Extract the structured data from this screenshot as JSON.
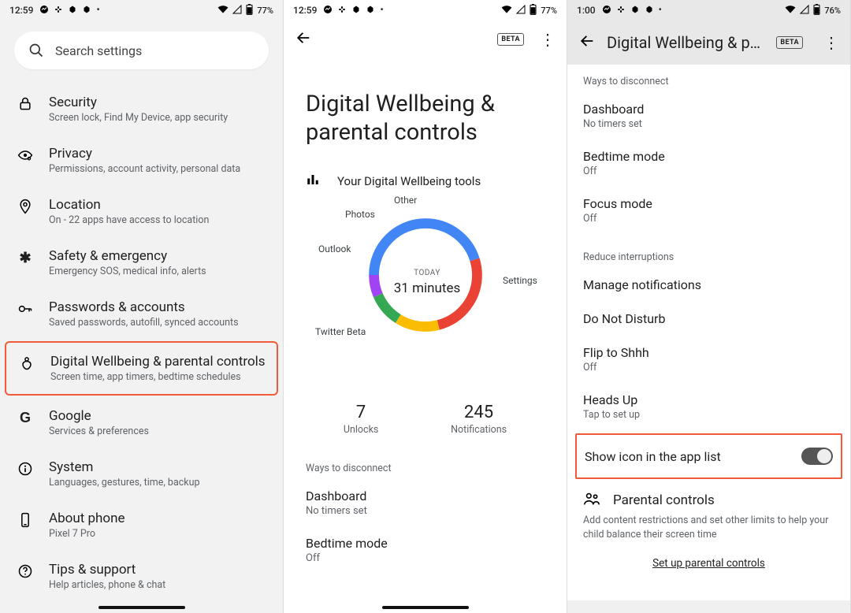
{
  "screen1": {
    "status": {
      "time": "12:59",
      "battery": "77%"
    },
    "search_placeholder": "Search settings",
    "items": [
      {
        "icon": "lock-icon",
        "title": "Security",
        "sub": "Screen lock, Find My Device, app security"
      },
      {
        "icon": "eye-icon",
        "title": "Privacy",
        "sub": "Permissions, account activity, personal data"
      },
      {
        "icon": "location-icon",
        "title": "Location",
        "sub": "On - 22 apps have access to location"
      },
      {
        "icon": "medical-icon",
        "title": "Safety & emergency",
        "sub": "Emergency SOS, medical info, alerts"
      },
      {
        "icon": "key-icon",
        "title": "Passwords & accounts",
        "sub": "Saved passwords, autofill, synced accounts"
      },
      {
        "icon": "wellbeing-icon",
        "title": "Digital Wellbeing & parental controls",
        "sub": "Screen time, app timers, bedtime schedules"
      },
      {
        "icon": "google-icon",
        "title": "Google",
        "sub": "Services & preferences"
      },
      {
        "icon": "info-icon",
        "title": "System",
        "sub": "Languages, gestures, time, backup"
      },
      {
        "icon": "phone-icon",
        "title": "About phone",
        "sub": "Pixel 7 Pro"
      },
      {
        "icon": "help-icon",
        "title": "Tips & support",
        "sub": "Help articles, phone & chat"
      }
    ]
  },
  "screen2": {
    "status": {
      "time": "12:59",
      "battery": "77%"
    },
    "beta_label": "BETA",
    "page_title": "Digital Wellbeing & parental controls",
    "tools_heading": "Your Digital Wellbeing tools",
    "donut_center": {
      "today": "TODAY",
      "value": "31 minutes"
    },
    "metrics": [
      {
        "value": "7",
        "label": "Unlocks"
      },
      {
        "value": "245",
        "label": "Notifications"
      }
    ],
    "section_ways": "Ways to disconnect",
    "rows": [
      {
        "title": "Dashboard",
        "sub": "No timers set"
      },
      {
        "title": "Bedtime mode",
        "sub": "Off"
      }
    ]
  },
  "chart_data": {
    "type": "pie",
    "title": "Your Digital Wellbeing tools",
    "categories": [
      "Settings",
      "Twitter Beta",
      "Outlook",
      "Photos",
      "Other"
    ],
    "values": [
      14,
      8,
      4,
      3,
      2
    ],
    "colors": [
      "#4285f4",
      "#ea4335",
      "#fbbc04",
      "#34a853",
      "#a142f4"
    ],
    "center_label_top": "TODAY",
    "center_label_main": "31 minutes"
  },
  "screen3": {
    "status": {
      "time": "1:00",
      "battery": "76%"
    },
    "beta_label": "BETA",
    "appbar_title": "Digital Wellbeing & pare...",
    "section_ways": "Ways to disconnect",
    "rows_ways": [
      {
        "title": "Dashboard",
        "sub": "No timers set"
      },
      {
        "title": "Bedtime mode",
        "sub": "Off"
      },
      {
        "title": "Focus mode",
        "sub": "Off"
      }
    ],
    "section_reduce": "Reduce interruptions",
    "rows_reduce": [
      {
        "title": "Manage notifications",
        "sub": ""
      },
      {
        "title": "Do Not Disturb",
        "sub": ""
      },
      {
        "title": "Flip to Shhh",
        "sub": "Off"
      },
      {
        "title": "Heads Up",
        "sub": "Tap to set up"
      }
    ],
    "show_icon_label": "Show icon in the app list",
    "pc_title": "Parental controls",
    "pc_sub": "Add content restrictions and set other limits to help your child balance their screen time",
    "pc_link": "Set up parental controls"
  }
}
